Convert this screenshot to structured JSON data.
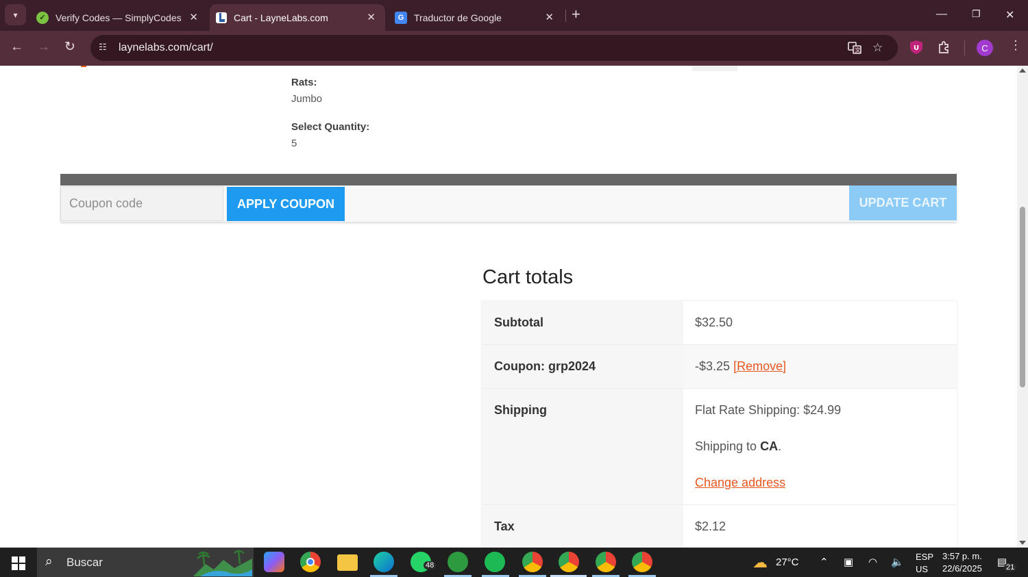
{
  "browser": {
    "tabs": [
      {
        "title": "Verify Codes — SimplyCodes",
        "icon": "simplycodes-icon",
        "active": false
      },
      {
        "title": "Cart - LayneLabs.com",
        "icon": "laynelabs-icon",
        "active": true
      },
      {
        "title": "Traductor de Google",
        "icon": "google-translate-icon",
        "active": false
      }
    ],
    "url": "laynelabs.com/cart/",
    "profile_initial": "C"
  },
  "cart_item": {
    "meta": [
      {
        "label": "Rats:",
        "value": "Jumbo"
      },
      {
        "label": "Select Quantity:",
        "value": "5"
      }
    ]
  },
  "actions": {
    "coupon_placeholder": "Coupon code",
    "apply_label": "APPLY COUPON",
    "update_label": "UPDATE CART"
  },
  "totals": {
    "title": "Cart totals",
    "subtotal_label": "Subtotal",
    "subtotal_value": "$32.50",
    "coupon_label": "Coupon: grp2024",
    "coupon_value": "-$3.25",
    "coupon_remove": "[Remove]",
    "shipping_label": "Shipping",
    "shipping_method": "Flat Rate Shipping: $24.99",
    "shipping_to_prefix": "Shipping to",
    "shipping_to_region": "CA",
    "shipping_to_suffix": ".",
    "change_address": "Change address",
    "tax_label": "Tax",
    "tax_value": "$2.12"
  },
  "taskbar": {
    "search_placeholder": "Buscar",
    "whatsapp_badge": "48",
    "weather": "27°C",
    "lang_top": "ESP",
    "lang_bottom": "US",
    "time": "3:57 p. m.",
    "date": "22/6/2025",
    "notifications": "21"
  },
  "colors": {
    "accent_blue": "#1e9bf0",
    "link_orange": "#e8561f",
    "chrome_frame": "#3a1e29"
  }
}
